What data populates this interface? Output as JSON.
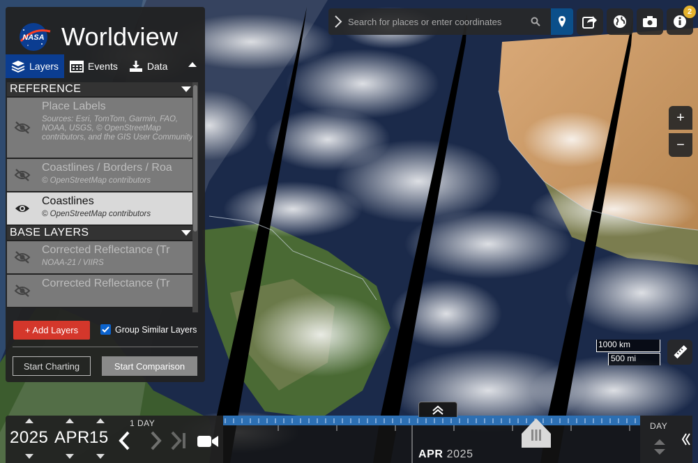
{
  "app": {
    "title": "Worldview",
    "logo": "nasa-logo"
  },
  "tabs": [
    {
      "label": "Layers",
      "icon": "layers-icon",
      "active": true
    },
    {
      "label": "Events",
      "icon": "calendar-icon",
      "active": false
    },
    {
      "label": "Data",
      "icon": "download-icon",
      "active": false
    }
  ],
  "layer_groups": [
    {
      "title": "REFERENCE",
      "layers": [
        {
          "name": "Place Labels",
          "source": "Sources: Esri, TomTom, Garmin, FAO, NOAA, USGS, © OpenStreetMap contributors, and the GIS User Community",
          "visible": false
        },
        {
          "name": "Coastlines / Borders / Roa",
          "source": "© OpenStreetMap contributors",
          "visible": false
        },
        {
          "name": "Coastlines",
          "source": "© OpenStreetMap contributors",
          "visible": true
        }
      ]
    },
    {
      "title": "BASE LAYERS",
      "layers": [
        {
          "name": "Corrected Reflectance (Tr",
          "source": "NOAA-21 / VIIRS",
          "visible": false
        },
        {
          "name": "Corrected Reflectance (Tr",
          "source": "",
          "visible": false
        }
      ]
    }
  ],
  "panel_actions": {
    "add_layers": "+ Add Layers",
    "group_similar": "Group Similar Layers",
    "group_similar_checked": true,
    "start_charting": "Start Charting",
    "start_comparison": "Start Comparison"
  },
  "search": {
    "placeholder": "Search for places or enter coordinates"
  },
  "toolbar": {
    "notification_count": "2"
  },
  "zoom": {
    "in": "+",
    "out": "−"
  },
  "scale": {
    "km": "1000 km",
    "mi": "500 mi"
  },
  "timeline": {
    "year": "2025",
    "month": "APR",
    "day": "15",
    "interval": "1 DAY",
    "axis_month": "APR",
    "axis_year": "2025",
    "zoom_level": "DAY"
  },
  "colors": {
    "accent": "#0b3d91",
    "add_button": "#d4372b",
    "timeline_bar": "#2c6fb3",
    "badge": "#e6b32e"
  }
}
